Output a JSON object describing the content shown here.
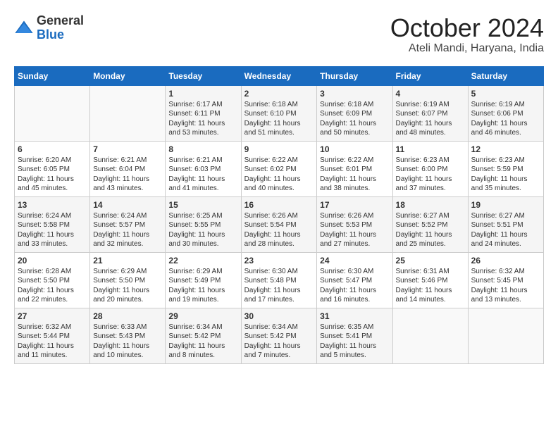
{
  "header": {
    "logo_general": "General",
    "logo_blue": "Blue",
    "month_title": "October 2024",
    "location": "Ateli Mandi, Haryana, India"
  },
  "columns": [
    "Sunday",
    "Monday",
    "Tuesday",
    "Wednesday",
    "Thursday",
    "Friday",
    "Saturday"
  ],
  "rows": [
    [
      {
        "day": "",
        "content": ""
      },
      {
        "day": "",
        "content": ""
      },
      {
        "day": "1",
        "content": "Sunrise: 6:17 AM\nSunset: 6:11 PM\nDaylight: 11 hours and 53 minutes."
      },
      {
        "day": "2",
        "content": "Sunrise: 6:18 AM\nSunset: 6:10 PM\nDaylight: 11 hours and 51 minutes."
      },
      {
        "day": "3",
        "content": "Sunrise: 6:18 AM\nSunset: 6:09 PM\nDaylight: 11 hours and 50 minutes."
      },
      {
        "day": "4",
        "content": "Sunrise: 6:19 AM\nSunset: 6:07 PM\nDaylight: 11 hours and 48 minutes."
      },
      {
        "day": "5",
        "content": "Sunrise: 6:19 AM\nSunset: 6:06 PM\nDaylight: 11 hours and 46 minutes."
      }
    ],
    [
      {
        "day": "6",
        "content": "Sunrise: 6:20 AM\nSunset: 6:05 PM\nDaylight: 11 hours and 45 minutes."
      },
      {
        "day": "7",
        "content": "Sunrise: 6:21 AM\nSunset: 6:04 PM\nDaylight: 11 hours and 43 minutes."
      },
      {
        "day": "8",
        "content": "Sunrise: 6:21 AM\nSunset: 6:03 PM\nDaylight: 11 hours and 41 minutes."
      },
      {
        "day": "9",
        "content": "Sunrise: 6:22 AM\nSunset: 6:02 PM\nDaylight: 11 hours and 40 minutes."
      },
      {
        "day": "10",
        "content": "Sunrise: 6:22 AM\nSunset: 6:01 PM\nDaylight: 11 hours and 38 minutes."
      },
      {
        "day": "11",
        "content": "Sunrise: 6:23 AM\nSunset: 6:00 PM\nDaylight: 11 hours and 37 minutes."
      },
      {
        "day": "12",
        "content": "Sunrise: 6:23 AM\nSunset: 5:59 PM\nDaylight: 11 hours and 35 minutes."
      }
    ],
    [
      {
        "day": "13",
        "content": "Sunrise: 6:24 AM\nSunset: 5:58 PM\nDaylight: 11 hours and 33 minutes."
      },
      {
        "day": "14",
        "content": "Sunrise: 6:24 AM\nSunset: 5:57 PM\nDaylight: 11 hours and 32 minutes."
      },
      {
        "day": "15",
        "content": "Sunrise: 6:25 AM\nSunset: 5:55 PM\nDaylight: 11 hours and 30 minutes."
      },
      {
        "day": "16",
        "content": "Sunrise: 6:26 AM\nSunset: 5:54 PM\nDaylight: 11 hours and 28 minutes."
      },
      {
        "day": "17",
        "content": "Sunrise: 6:26 AM\nSunset: 5:53 PM\nDaylight: 11 hours and 27 minutes."
      },
      {
        "day": "18",
        "content": "Sunrise: 6:27 AM\nSunset: 5:52 PM\nDaylight: 11 hours and 25 minutes."
      },
      {
        "day": "19",
        "content": "Sunrise: 6:27 AM\nSunset: 5:51 PM\nDaylight: 11 hours and 24 minutes."
      }
    ],
    [
      {
        "day": "20",
        "content": "Sunrise: 6:28 AM\nSunset: 5:50 PM\nDaylight: 11 hours and 22 minutes."
      },
      {
        "day": "21",
        "content": "Sunrise: 6:29 AM\nSunset: 5:50 PM\nDaylight: 11 hours and 20 minutes."
      },
      {
        "day": "22",
        "content": "Sunrise: 6:29 AM\nSunset: 5:49 PM\nDaylight: 11 hours and 19 minutes."
      },
      {
        "day": "23",
        "content": "Sunrise: 6:30 AM\nSunset: 5:48 PM\nDaylight: 11 hours and 17 minutes."
      },
      {
        "day": "24",
        "content": "Sunrise: 6:30 AM\nSunset: 5:47 PM\nDaylight: 11 hours and 16 minutes."
      },
      {
        "day": "25",
        "content": "Sunrise: 6:31 AM\nSunset: 5:46 PM\nDaylight: 11 hours and 14 minutes."
      },
      {
        "day": "26",
        "content": "Sunrise: 6:32 AM\nSunset: 5:45 PM\nDaylight: 11 hours and 13 minutes."
      }
    ],
    [
      {
        "day": "27",
        "content": "Sunrise: 6:32 AM\nSunset: 5:44 PM\nDaylight: 11 hours and 11 minutes."
      },
      {
        "day": "28",
        "content": "Sunrise: 6:33 AM\nSunset: 5:43 PM\nDaylight: 11 hours and 10 minutes."
      },
      {
        "day": "29",
        "content": "Sunrise: 6:34 AM\nSunset: 5:42 PM\nDaylight: 11 hours and 8 minutes."
      },
      {
        "day": "30",
        "content": "Sunrise: 6:34 AM\nSunset: 5:42 PM\nDaylight: 11 hours and 7 minutes."
      },
      {
        "day": "31",
        "content": "Sunrise: 6:35 AM\nSunset: 5:41 PM\nDaylight: 11 hours and 5 minutes."
      },
      {
        "day": "",
        "content": ""
      },
      {
        "day": "",
        "content": ""
      }
    ]
  ]
}
